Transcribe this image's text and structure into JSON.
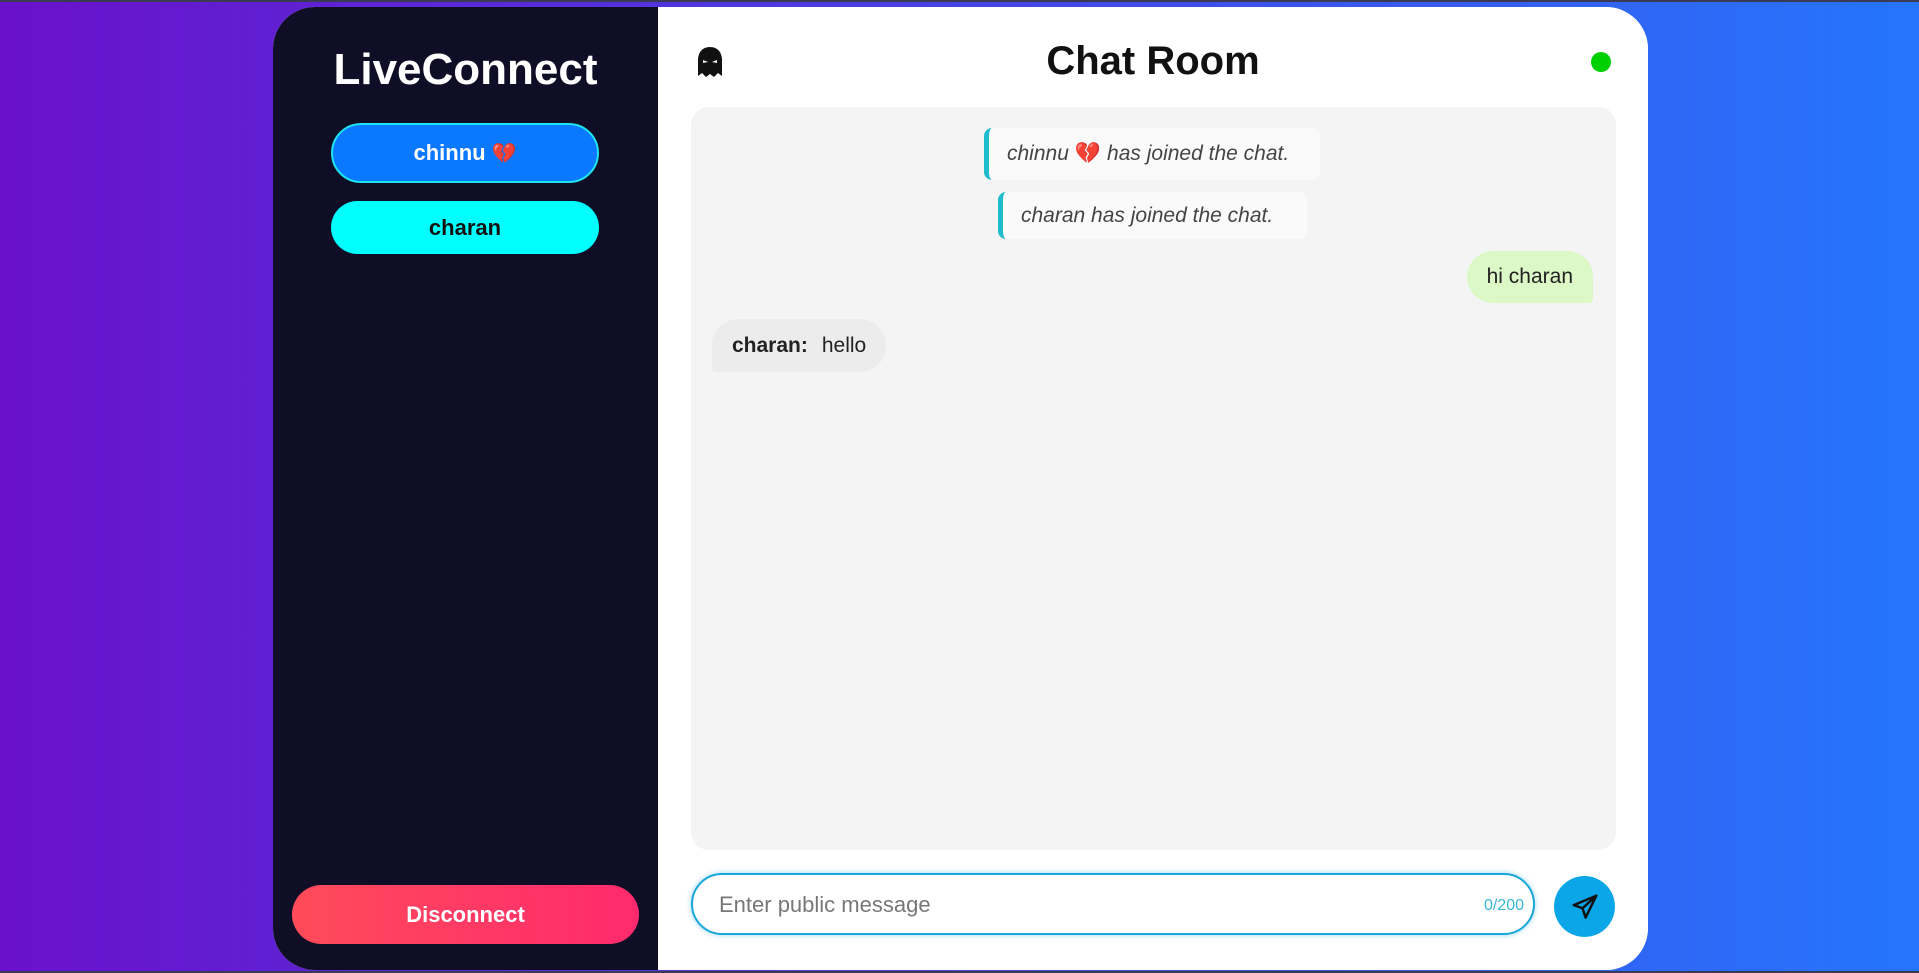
{
  "app": {
    "brand": "LiveConnect"
  },
  "sidebar": {
    "users": [
      {
        "name": "chinnu",
        "emoji": "💔"
      },
      {
        "name": "charan"
      }
    ],
    "disconnect_label": "Disconnect"
  },
  "header": {
    "title": "Chat Room",
    "status_color": "#00d000",
    "status": "online"
  },
  "messages": {
    "system": [
      {
        "prefix": "chinnu",
        "emoji": "💔",
        "text": "has joined the chat."
      },
      {
        "text": "charan has joined the chat."
      }
    ],
    "outgoing": [
      {
        "text": "hi charan"
      }
    ],
    "incoming": [
      {
        "sender": "charan:",
        "text": "hello"
      }
    ]
  },
  "composer": {
    "placeholder": "Enter public message",
    "value": "",
    "counter": "0/200",
    "send_icon": "send-icon"
  },
  "colors": {
    "accent": "#0a78ff",
    "cyan": "#00ffff",
    "disconnect": "#ff3a64",
    "sidebar_bg": "#0f0e26",
    "outgoing_bubble": "#dcf8c6"
  }
}
